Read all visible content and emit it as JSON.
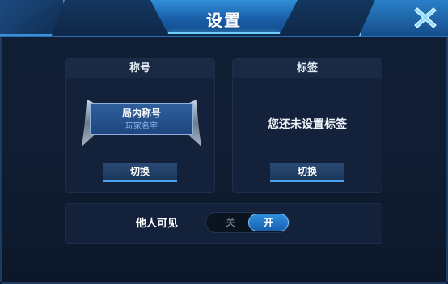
{
  "header": {
    "title": "设置"
  },
  "nickname_panel": {
    "heading": "称号",
    "plate_title": "局内称号",
    "plate_subtitle": "玩家名字",
    "switch_label": "切换"
  },
  "tag_panel": {
    "heading": "标签",
    "empty_text": "您还未设置标签",
    "switch_label": "切换"
  },
  "visibility": {
    "label": "他人可见",
    "off_label": "关",
    "on_label": "开",
    "state": "on"
  },
  "icons": {
    "close": "close-icon"
  },
  "colors": {
    "accent": "#2f8fe0",
    "panel": "#13223a",
    "close": "#8fdcff"
  }
}
